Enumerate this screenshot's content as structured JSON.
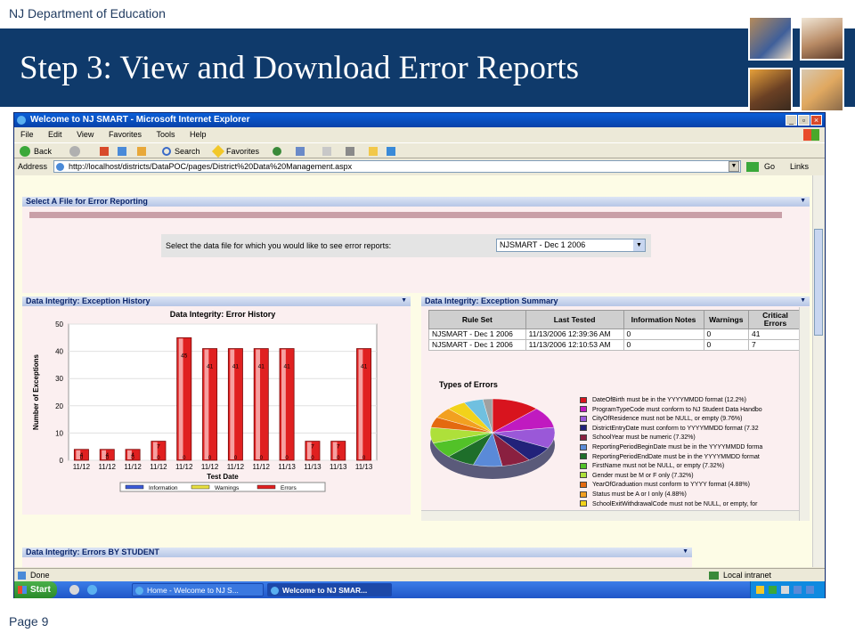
{
  "slide": {
    "org": "NJ Department of Education",
    "title": "Step 3:  View and Download Error Reports",
    "page": "Page 9"
  },
  "browser": {
    "title": "Welcome to NJ SMART - Microsoft Internet Explorer",
    "menu": [
      "File",
      "Edit",
      "View",
      "Favorites",
      "Tools",
      "Help"
    ],
    "toolbar": {
      "back": "Back",
      "search": "Search",
      "favorites": "Favorites"
    },
    "address_label": "Address",
    "address": "http://localhost/districts/DataPOC/pages/District%20Data%20Management.aspx",
    "go": "Go",
    "links": "Links",
    "status_left": "Done",
    "status_right": "Local intranet"
  },
  "taskbar": {
    "start": "Start",
    "task1": "Home - Welcome to NJ S...",
    "task2": "Welcome to NJ SMAR..."
  },
  "select_panel": {
    "header": "Select A File for Error Reporting",
    "prompt": "Select the data file for which you would like to see error reports:",
    "selected": "NJSMART - Dec 1 2006"
  },
  "history_panel": {
    "header": "Data Integrity: Exception History"
  },
  "summary_panel": {
    "header": "Data Integrity: Exception Summary",
    "columns": [
      "Rule Set",
      "Last Tested",
      "Information Notes",
      "Warnings",
      "Critical Errors"
    ],
    "rows": [
      [
        "NJSMART - Dec 1 2006",
        "11/13/2006 12:39:36 AM",
        "0",
        "0",
        "41"
      ],
      [
        "NJSMART - Dec 1 2006",
        "11/13/2006 12:10:53 AM",
        "0",
        "0",
        "7"
      ]
    ],
    "pie_title": "Types of Errors",
    "pie_legend": [
      {
        "label": "DateOfBirth must be in the YYYYMMDD format (12.2%)",
        "color": "#d8141e"
      },
      {
        "label": "ProgramTypeCode must conform to NJ Student Data Handbo",
        "color": "#c01ac0"
      },
      {
        "label": "CityOfResidence must not be NULL, or empty (9.76%)",
        "color": "#9a58d8"
      },
      {
        "label": "DistrictEntryDate must conform to YYYYMMDD format (7.32",
        "color": "#22227a"
      },
      {
        "label": "SchoolYear must be numeric (7.32%)",
        "color": "#8a2040"
      },
      {
        "label": "ReportingPeriodBeginDate must be in the YYYYMMDD forma",
        "color": "#5a8ad8"
      },
      {
        "label": "ReportingPeriodEndDate must be in the YYYYMMDD format",
        "color": "#1e6e2a"
      },
      {
        "label": "FirstName must not be NULL, or empty (7.32%)",
        "color": "#52c228"
      },
      {
        "label": "Gender must be M or F only (7.32%)",
        "color": "#aee03a"
      },
      {
        "label": "YearOfGraduation must conform to YYYY format (4.88%)",
        "color": "#e46a10"
      },
      {
        "label": "Status must be A or I only (4.88%)",
        "color": "#f2a020"
      },
      {
        "label": "SchoolExitWithdrawalCode must not be NULL, or empty, for",
        "color": "#f2d21a"
      }
    ]
  },
  "students_panel": {
    "header": "Data Integrity: Errors BY STUDENT"
  },
  "chart_data": {
    "type": "bar",
    "title": "Data Integrity:  Error History",
    "xlabel": "Test Date",
    "ylabel": "Number of Exceptions",
    "ylim": [
      0,
      50
    ],
    "yticks": [
      0,
      10,
      20,
      30,
      40,
      50
    ],
    "categories": [
      "11/12",
      "11/12",
      "11/12",
      "11/12",
      "11/12",
      "11/12",
      "11/12",
      "11/12",
      "11/13",
      "11/13",
      "11/13",
      "11/13"
    ],
    "series": [
      {
        "name": "Information",
        "values": [
          0,
          0,
          0,
          0,
          0,
          0,
          0,
          0,
          0,
          0,
          0,
          0
        ],
        "color": "#3a5ad8"
      },
      {
        "name": "Warnings",
        "values": [
          0,
          0,
          0,
          0,
          0,
          0,
          0,
          0,
          0,
          0,
          0,
          0
        ],
        "color": "#e8e040"
      },
      {
        "name": "Errors",
        "values": [
          4,
          4,
          4,
          7,
          45,
          41,
          41,
          41,
          41,
          7,
          7,
          41
        ],
        "color": "#e02020"
      }
    ],
    "grid": true,
    "legend": "bottom"
  }
}
